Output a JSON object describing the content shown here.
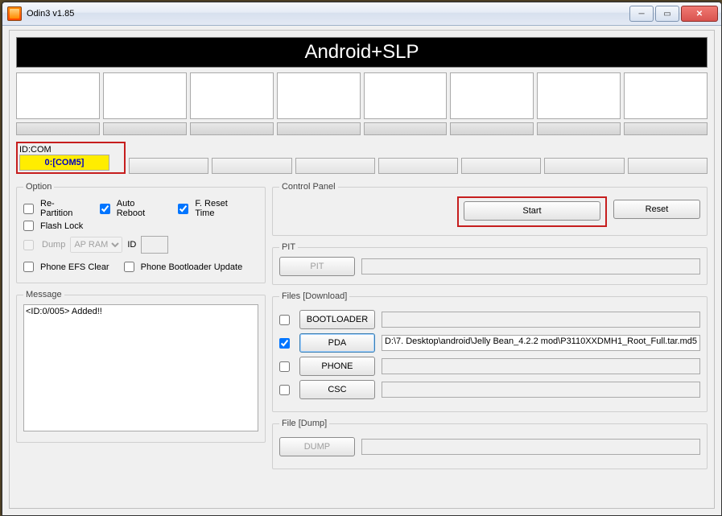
{
  "window": {
    "title": "Odin3 v1.85"
  },
  "banner": "Android+SLP",
  "idcom": {
    "label": "ID:COM",
    "active": "0:[COM5]"
  },
  "option": {
    "legend": "Option",
    "repartition": "Re-Partition",
    "autoreboot": "Auto Reboot",
    "freset": "F. Reset Time",
    "flashlock": "Flash Lock",
    "dump": "Dump",
    "dump_sel": "AP RAM",
    "idlabel": "ID",
    "efsclear": "Phone EFS Clear",
    "bootupdate": "Phone Bootloader Update"
  },
  "message": {
    "legend": "Message",
    "text": "<ID:0/005> Added!!"
  },
  "control": {
    "legend": "Control Panel",
    "start": "Start",
    "reset": "Reset"
  },
  "pit": {
    "legend": "PIT",
    "btn": "PIT",
    "path": ""
  },
  "files": {
    "legend": "Files [Download]",
    "bootloader": "BOOTLOADER",
    "pda": "PDA",
    "phone": "PHONE",
    "csc": "CSC",
    "pda_path": "D:\\7. Desktop\\android\\Jelly Bean_4.2.2 mod\\P3110XXDMH1_Root_Full.tar.md5"
  },
  "dumpfile": {
    "legend": "File [Dump]",
    "btn": "DUMP"
  },
  "checked": {
    "autoreboot": true,
    "freset": true,
    "pda": true
  }
}
